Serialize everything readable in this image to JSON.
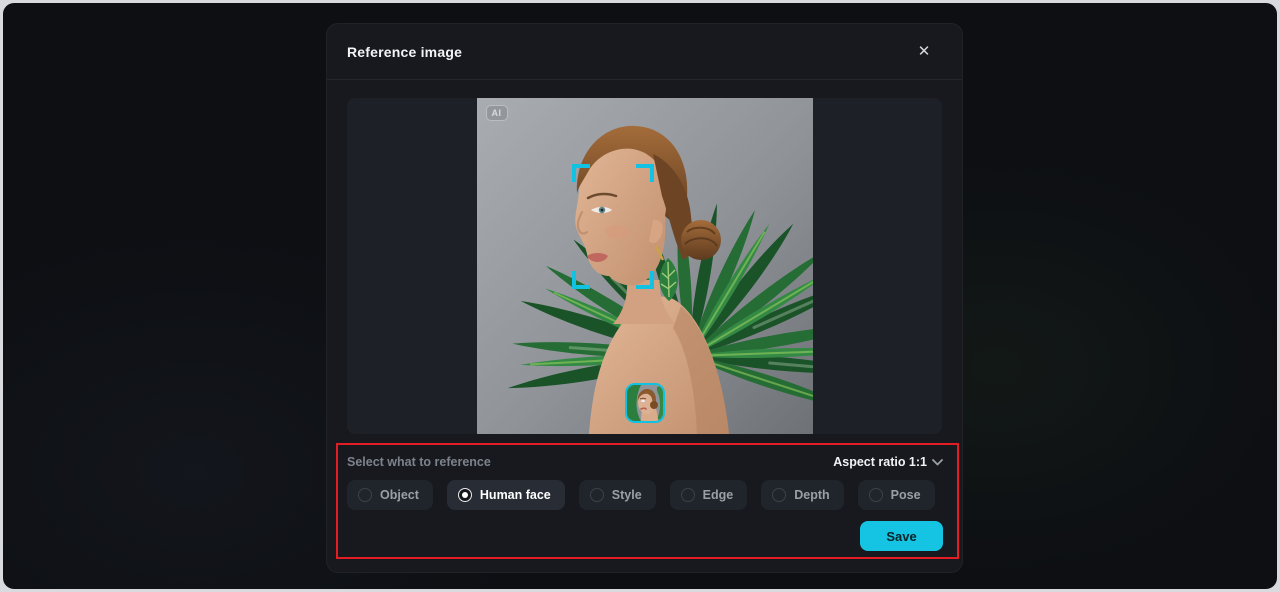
{
  "modal": {
    "title": "Reference image",
    "close_glyph": "✕"
  },
  "image_area": {
    "ai_badge": "AI"
  },
  "reference_panel": {
    "label": "Select what to reference",
    "aspect_ratio_label": "Aspect ratio 1:1",
    "options": [
      {
        "label": "Object",
        "selected": false
      },
      {
        "label": "Human face",
        "selected": true
      },
      {
        "label": "Style",
        "selected": false
      },
      {
        "label": "Edge",
        "selected": false
      },
      {
        "label": "Depth",
        "selected": false
      },
      {
        "label": "Pose",
        "selected": false
      }
    ],
    "save_label": "Save"
  },
  "colors": {
    "accent_cyan": "#15c4e2",
    "annotation_red": "#e41d24",
    "modal_bg": "#17191e",
    "image_container_bg": "#1d2026",
    "pill_bg": "#20242b",
    "pill_selected_bg": "#282c34"
  }
}
